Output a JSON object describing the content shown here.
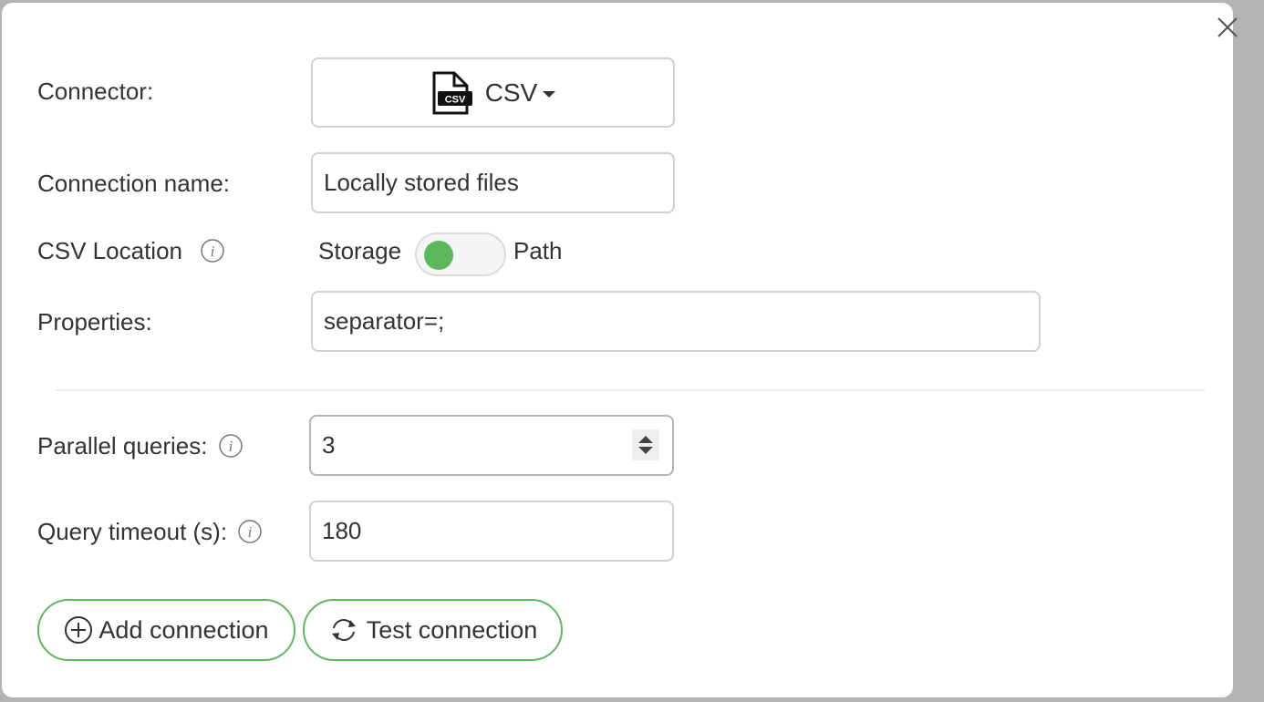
{
  "dialog": {
    "close_label": "Close"
  },
  "form": {
    "connector": {
      "label": "Connector:",
      "selected": "CSV",
      "icon": "csv-file-icon",
      "icon_badge": "CSV"
    },
    "connection_name": {
      "label": "Connection name:",
      "value": "Locally stored files"
    },
    "csv_location": {
      "label": "CSV Location",
      "option_left": "Storage",
      "option_right": "Path",
      "selected": "Storage",
      "toggle_color": "#5cb85c"
    },
    "properties": {
      "label": "Properties:",
      "value": "separator=;"
    },
    "parallel_queries": {
      "label": "Parallel queries:",
      "value": "3"
    },
    "query_timeout": {
      "label": "Query timeout (s):",
      "value": "180"
    }
  },
  "actions": {
    "add_connection": "Add connection",
    "test_connection": "Test connection",
    "accent_color": "#5cb85c"
  }
}
